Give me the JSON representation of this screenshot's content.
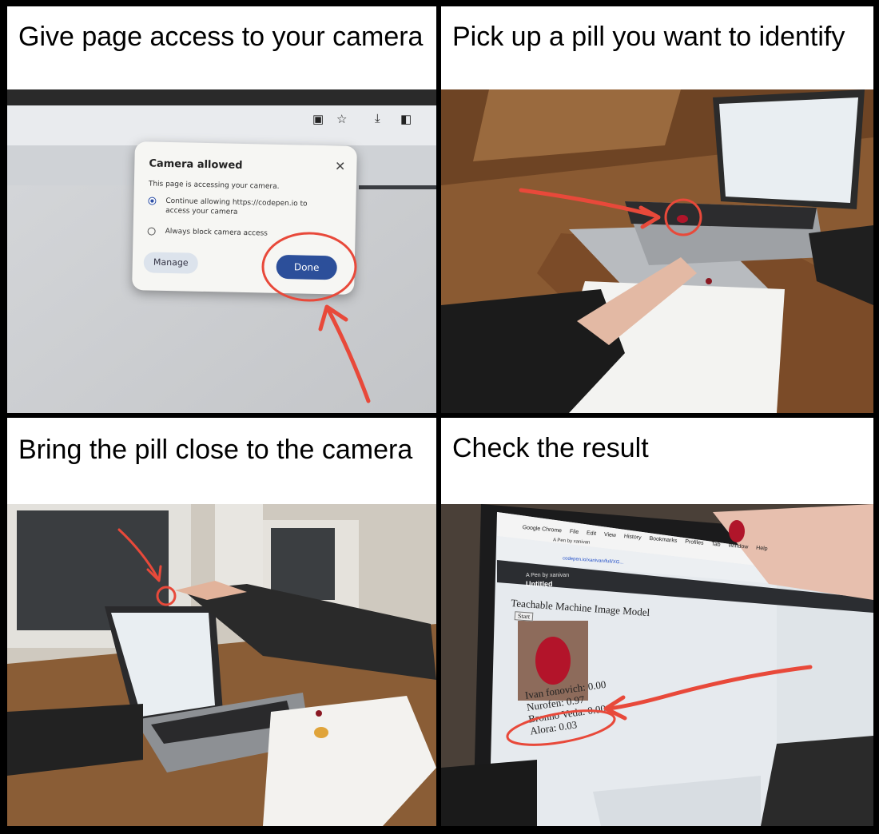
{
  "panels": [
    {
      "caption": "Give page access to your camera"
    },
    {
      "caption": "Pick up a pill you want to identify"
    },
    {
      "caption": "Bring the pill close to the camera"
    },
    {
      "caption": "Check the result"
    }
  ],
  "dialog": {
    "title": "Camera allowed",
    "close": "✕",
    "description": "This page is accessing your camera.",
    "option_allow": "Continue allowing https://codepen.io to access your camera",
    "option_block": "Always block camera access",
    "manage_label": "Manage",
    "done_label": "Done"
  },
  "result_screen": {
    "chrome_menu": [
      "Google Chrome",
      "File",
      "Edit",
      "View",
      "History",
      "Bookmarks",
      "Profiles",
      "Tab",
      "Window",
      "Help"
    ],
    "tab_label": "A Pen by xanivan",
    "url": "codepen.io/xanivan/full/XG...",
    "pen_by": "A Pen by xanivan",
    "pen_title": "Untitled",
    "app_title": "Teachable Machine Image Model",
    "start_label": "Start",
    "results": [
      "Ivan fonovich: 0.00",
      "Nurofen: 0.97",
      "Bronno Veda: 0.00",
      "Alora: 0.03"
    ]
  },
  "colors": {
    "annotation": "#e8493a",
    "done_button": "#2c4f9a",
    "border": "#000000"
  }
}
